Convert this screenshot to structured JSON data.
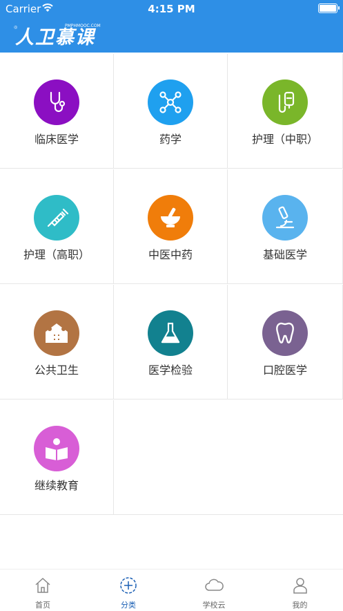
{
  "status_bar": {
    "carrier": "Carrier",
    "time": "4:15 PM"
  },
  "header": {
    "logo_text": "人卫慕课",
    "logo_sub": "PMPHMOOC.COM"
  },
  "categories": [
    {
      "label": "临床医学",
      "icon": "stethoscope-icon",
      "color": "#8b0fc2"
    },
    {
      "label": "药学",
      "icon": "molecule-icon",
      "color": "#1fa0ef"
    },
    {
      "label": "护理（中职）",
      "icon": "iv-drip-icon",
      "color": "#7ab62a"
    },
    {
      "label": "护理（高职）",
      "icon": "syringe-icon",
      "color": "#2fbcc7"
    },
    {
      "label": "中医中药",
      "icon": "mortar-pestle-icon",
      "color": "#f07d0a"
    },
    {
      "label": "基础医学",
      "icon": "microscope-icon",
      "color": "#59b3ee"
    },
    {
      "label": "公共卫生",
      "icon": "family-health-icon",
      "color": "#b27443"
    },
    {
      "label": "医学检验",
      "icon": "flask-icon",
      "color": "#12818f"
    },
    {
      "label": "口腔医学",
      "icon": "tooth-icon",
      "color": "#7a6291"
    },
    {
      "label": "继续教育",
      "icon": "reader-book-icon",
      "color": "#d85ed6"
    }
  ],
  "tabbar": {
    "items": [
      {
        "label": "首页",
        "icon": "home-icon"
      },
      {
        "label": "分类",
        "icon": "category-plus-icon",
        "active": true
      },
      {
        "label": "学校云",
        "icon": "cloud-icon"
      },
      {
        "label": "我的",
        "icon": "user-icon"
      }
    ]
  }
}
